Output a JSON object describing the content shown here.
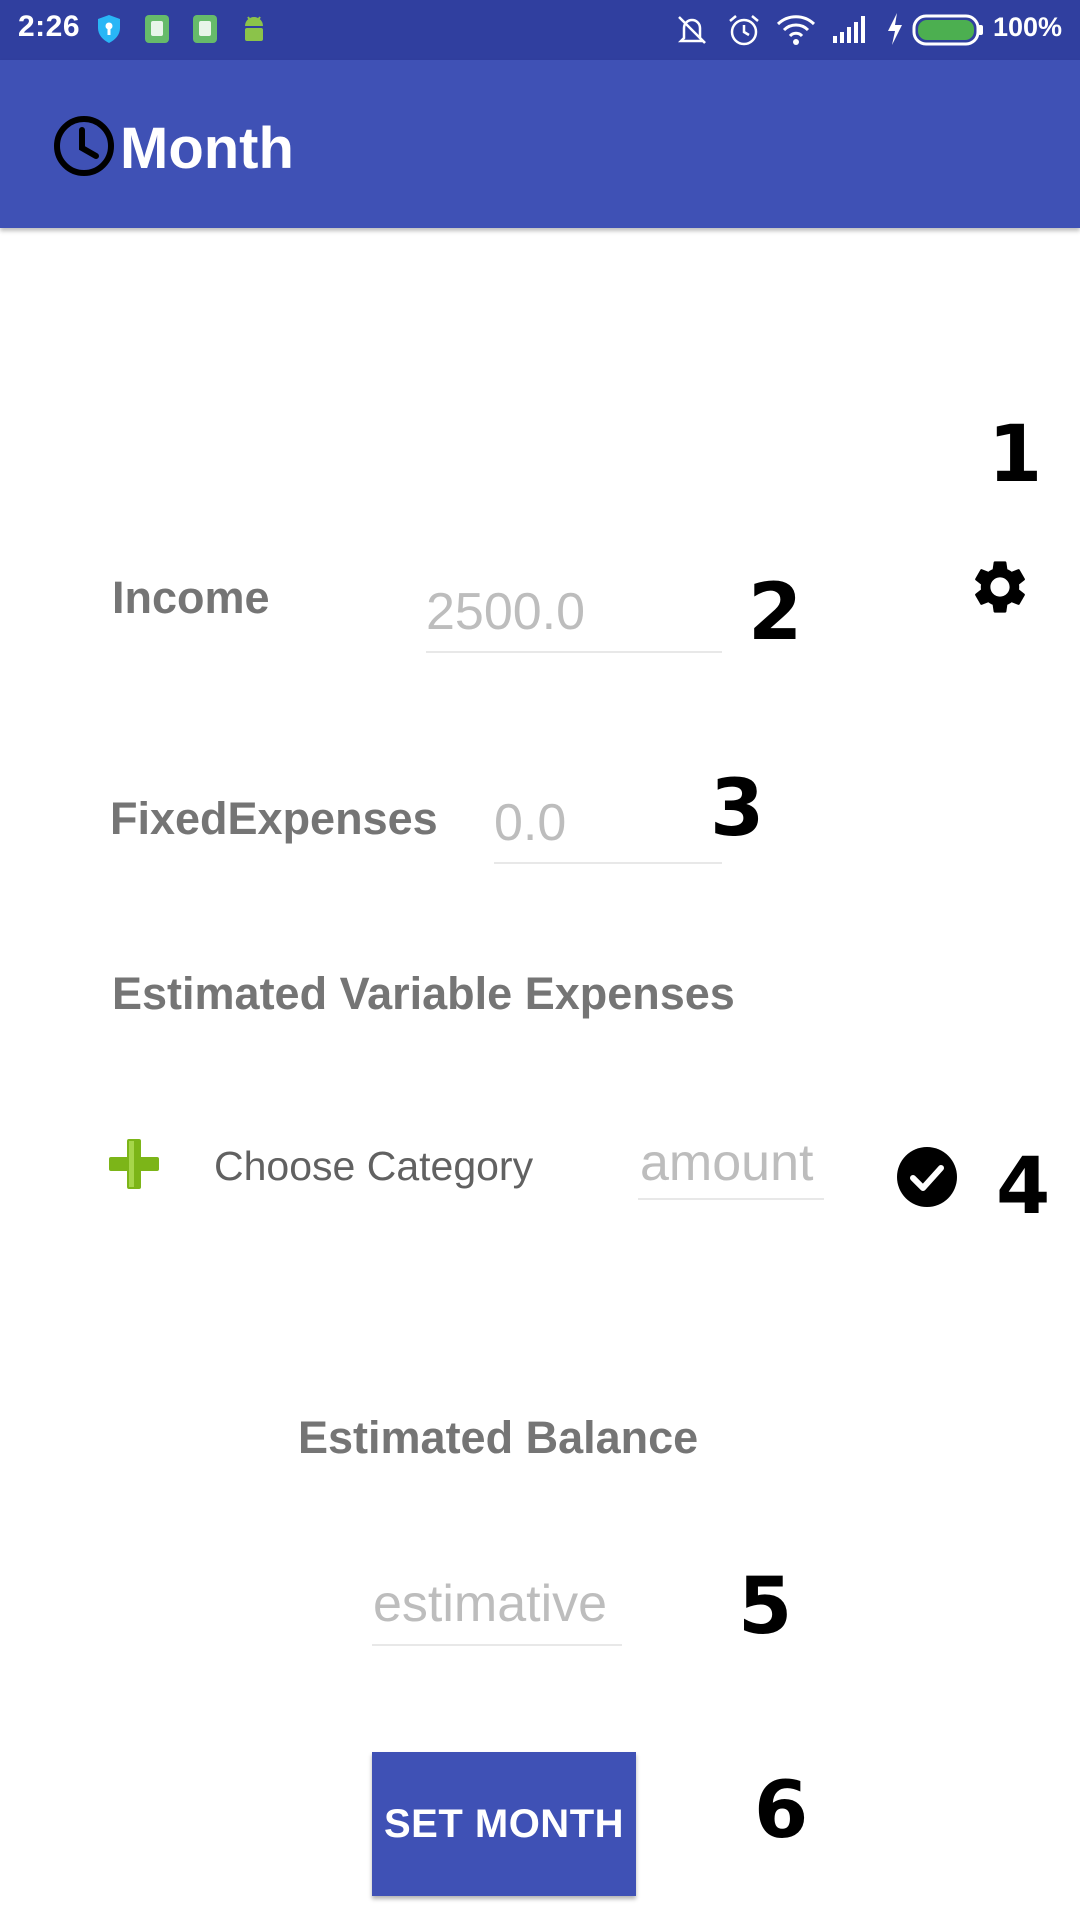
{
  "status_bar": {
    "time": "2:26",
    "battery_percent": "100%",
    "icons": [
      "shield-icon",
      "sim-icon",
      "sim-icon",
      "android-icon",
      "mute-icon",
      "alarm-icon",
      "wifi-icon",
      "signal-icon",
      "charging-icon",
      "battery-icon"
    ]
  },
  "app_bar": {
    "icon": "clock-icon",
    "title": "Month"
  },
  "form": {
    "settings_icon": "gear-icon",
    "income": {
      "label": "Income",
      "value": "2500.0"
    },
    "fixed_expenses": {
      "label": "FixedExpenses",
      "value": "0.0"
    },
    "variable_section_title": "Estimated Variable Expenses",
    "variable_row": {
      "add_icon": "plus-icon",
      "category_placeholder": "Choose Category",
      "amount_placeholder": "amount",
      "confirm_icon": "check-circle-icon"
    },
    "balance_title": "Estimated Balance",
    "balance_placeholder": "estimative",
    "submit_label": "SET MONTH"
  },
  "annotations": {
    "a1": "1",
    "a2": "2",
    "a3": "3",
    "a4": "4",
    "a5": "5",
    "a6": "6"
  },
  "colors": {
    "status_bar": "#303f9f",
    "app_bar": "#3f51b5",
    "label": "#757575",
    "hint": "#bdbdbd",
    "add_green": "#7cb518",
    "battery_green": "#4caf50"
  }
}
